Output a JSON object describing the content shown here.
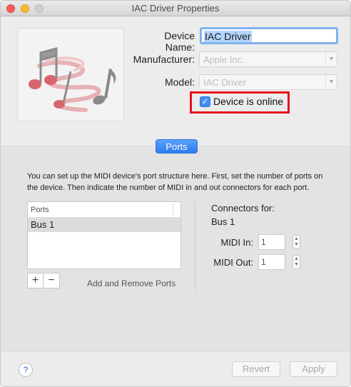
{
  "window": {
    "title": "IAC Driver Properties"
  },
  "device": {
    "name_label": "Device Name:",
    "name_value": "IAC Driver",
    "manufacturer_label": "Manufacturer:",
    "manufacturer_value": "Apple Inc.",
    "model_label": "Model:",
    "model_value": "IAC Driver",
    "online_label": "Device is online",
    "online_checked": true
  },
  "tabs": [
    {
      "label": "Ports",
      "selected": true
    }
  ],
  "ports": {
    "description": "You can set up the MIDI device's port structure here. First, set the number of ports on the device. Then indicate the number of MIDI in and out connectors for each port.",
    "list_header": "Ports",
    "items": [
      {
        "label": "Bus 1",
        "selected": true
      }
    ],
    "add_symbol": "+",
    "remove_symbol": "−",
    "add_remove_caption": "Add and Remove Ports",
    "connectors_title": "Connectors for:",
    "connectors_bus": "Bus 1",
    "midi_in_label": "MIDI In:",
    "midi_in_value": "1",
    "midi_out_label": "MIDI Out:",
    "midi_out_value": "1"
  },
  "footer": {
    "help_symbol": "?",
    "revert_label": "Revert",
    "apply_label": "Apply"
  },
  "colors": {
    "accent": "#3d8ff5",
    "highlight_box": "#e5101b"
  }
}
